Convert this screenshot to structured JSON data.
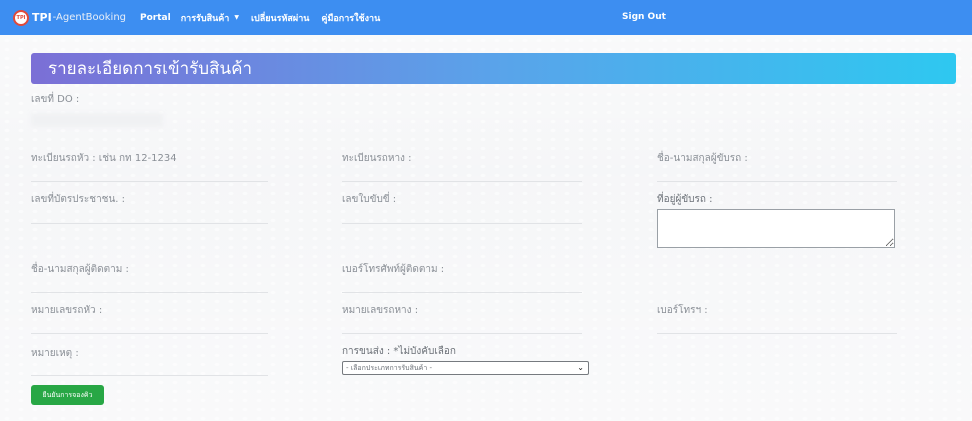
{
  "navbar": {
    "brand_tpi": "TPI",
    "brand_rest": "-AgentBooking",
    "logo_text": "TPI",
    "portal": "Portal",
    "receive_menu": "การรับสินค้า",
    "change_password": "เปลี่ยนรหัสผ่าน",
    "manual": "คู่มือการใช้งาน",
    "sign_out": "Sign Out",
    "color": "#3d8ef1"
  },
  "page": {
    "title": "รายละเอียดการเข้ารับสินค้า"
  },
  "form": {
    "do_number": "เลขที่ DO :",
    "head_plate": "ทะเบียนรถหัว : เช่น กท 12-1234",
    "tail_plate": "ทะเบียนรถหาง :",
    "driver_name": "ชื่อ-นามสกุลผู้ขับรถ :",
    "id_card": "เลขที่บัตรประชาชน. :",
    "license": "เลขใบขับขี่ :",
    "driver_address": "ที่อยู่ผู้ขับรถ :",
    "follower_name": "ชื่อ-นามสกุลผู้ติดตาม :",
    "follower_phone": "เบอร์โทรศัพท์ผู้ติดตาม :",
    "head_number": "หมายเลขรถหัว :",
    "tail_number": "หมายเลขรถหาง :",
    "phone": "เบอร์โทรฯ :",
    "remark": "หมายเหตุ :",
    "transport": "การขนส่ง : *ไม่บังคับเลือก",
    "transport_select": "- เลือกประเภทการรับสินค้า -",
    "confirm_button": "ยืนยันการจองคิว"
  },
  "colors": {
    "title_gradient_start": "#7b6fd6",
    "title_gradient_end": "#2ec8f0",
    "confirm": "#28a745"
  }
}
